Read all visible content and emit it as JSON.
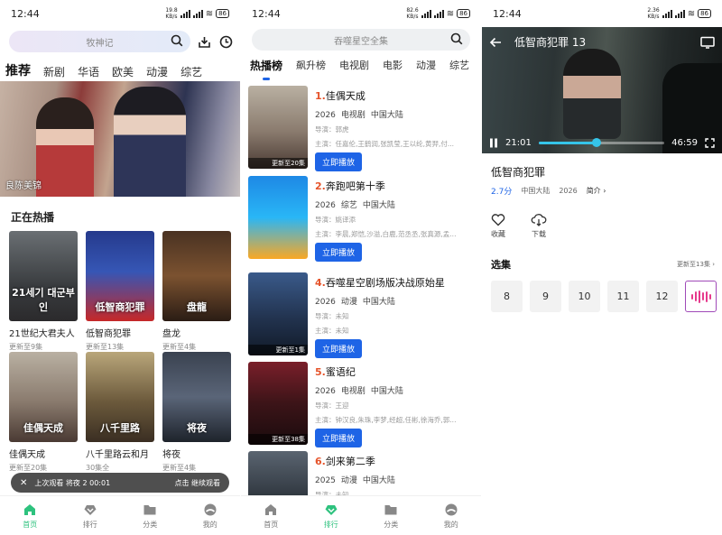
{
  "status": {
    "time": "12:44",
    "battery": "86"
  },
  "home": {
    "search_placeholder": "牧神记",
    "tabs": [
      "推荐",
      "新剧",
      "华语",
      "欧美",
      "动漫",
      "综艺"
    ],
    "banner_caption": "良陈美锦",
    "section_title": "正在热播",
    "cards": [
      {
        "title": "21世纪大君夫人",
        "sub": "更新至9集",
        "poster_text": "21세기 대군부인"
      },
      {
        "title": "低智商犯罪",
        "sub": "更新至13集",
        "poster_text": "低智商犯罪"
      },
      {
        "title": "盘龙",
        "sub": "更新至4集",
        "poster_text": "盘龍"
      },
      {
        "title": "佳偶天成",
        "sub": "更新至20集",
        "poster_text": "佳偶天成"
      },
      {
        "title": "八千里路云和月",
        "sub": "30集全",
        "poster_text": "八千里路"
      },
      {
        "title": "将夜",
        "sub": "更新至4集",
        "poster_text": "将夜"
      }
    ],
    "toast": {
      "text": "上次观看 将夜 2  00:01",
      "action": "点击 继续观看"
    },
    "nav": [
      "首页",
      "排行",
      "分类",
      "我的"
    ]
  },
  "ranking": {
    "search_placeholder": "吞噬星空全集",
    "tabs": [
      "热播榜",
      "飙升榜",
      "电视剧",
      "电影",
      "动漫",
      "综艺"
    ],
    "play_label": "立即播放",
    "items": [
      {
        "num": "1.",
        "title": "佳偶天成",
        "year": "2026",
        "genre": "电视剧",
        "region": "中国大陆",
        "director": "导演：郭虎",
        "cast": "主演：任嘉伦,王鹤润,张凯莹,王以纶,黄羿,付...",
        "update": "更新至20集"
      },
      {
        "num": "2.",
        "title": "奔跑吧第十季",
        "year": "2026",
        "genre": "综艺",
        "region": "中国大陆",
        "director": "导演：姚译添",
        "cast": "主演：李晨,郑恺,沙溢,白鹿,范丞丞,张真源,孟...",
        "update": ""
      },
      {
        "num": "4.",
        "title": "吞噬星空剧场版决战原始星",
        "year": "2026",
        "genre": "动漫",
        "region": "中国大陆",
        "director": "导演：未知",
        "cast": "主演：未知",
        "update": "更新至1集"
      },
      {
        "num": "5.",
        "title": "蜜语纪",
        "year": "2026",
        "genre": "电视剧",
        "region": "中国大陆",
        "director": "导演：王迎",
        "cast": "主演：钟汉良,朱珠,李梦,经超,任彬,徐海乔,郭...",
        "update": "更新至38集"
      },
      {
        "num": "6.",
        "title": "剑来第二季",
        "year": "2025",
        "genre": "动漫",
        "region": "中国大陆",
        "director": "导演：未知",
        "cast": "",
        "update": ""
      }
    ],
    "nav": [
      "首页",
      "排行",
      "分类",
      "我的"
    ]
  },
  "detail": {
    "player_title": "低智商犯罪 13",
    "time_current": "21:01",
    "time_total": "46:59",
    "progress": 0.46,
    "title": "低智商犯罪",
    "score": "2.7分",
    "region": "中国大陆",
    "year": "2026",
    "intro": "简介",
    "actions": [
      "收藏",
      "下载"
    ],
    "episodes_label": "选集",
    "episodes_update": "更新至13集",
    "episodes": [
      "8",
      "9",
      "10",
      "11",
      "12"
    ]
  }
}
